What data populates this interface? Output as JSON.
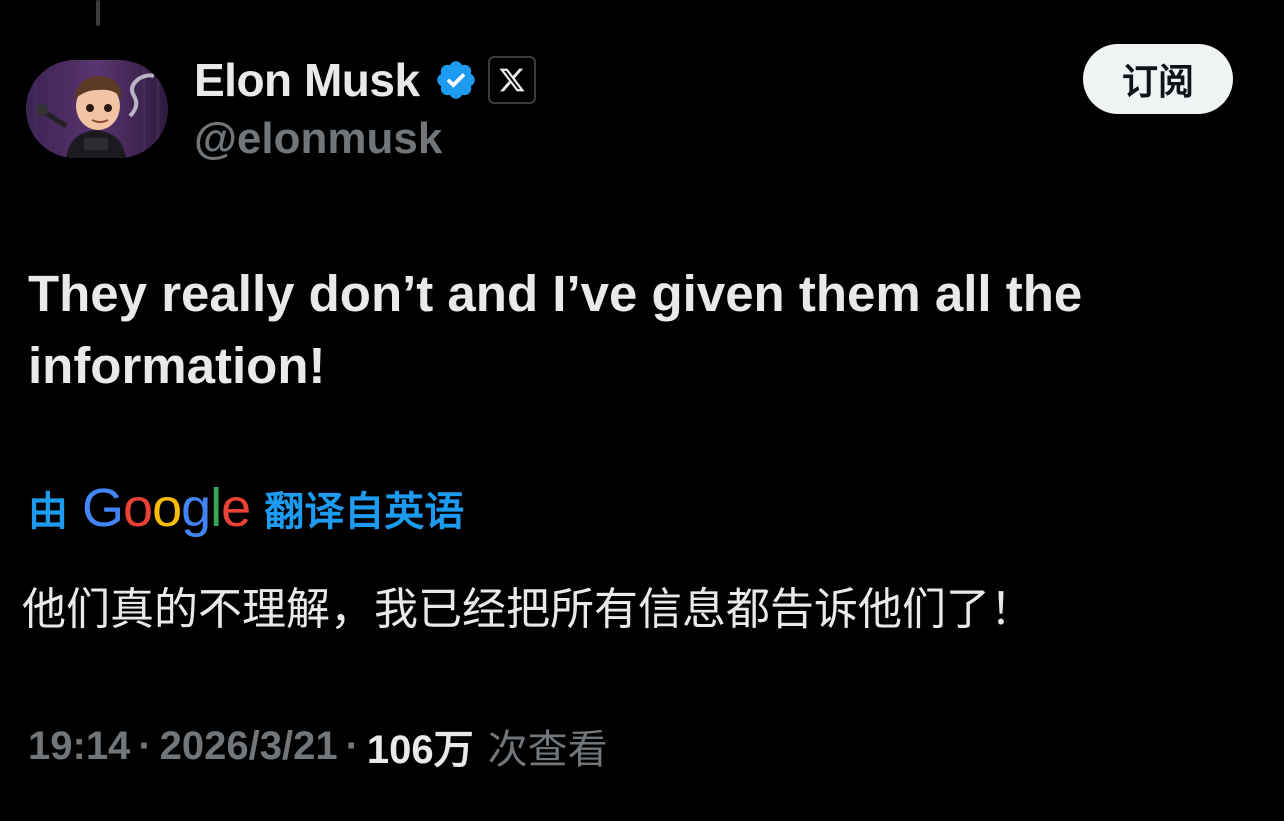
{
  "author": {
    "display_name": "Elon Musk",
    "handle": "@elonmusk",
    "verified_badge_icon": "verified-checkmark-icon",
    "affiliate_icon": "x-logo-icon",
    "avatar_icon": "cartoon-avatar",
    "colors": {
      "verified": "#1d9bf0"
    }
  },
  "actions": {
    "subscribe_label": "订阅"
  },
  "tweet": {
    "text": "They really don’t and I’ve given them all the information!",
    "translation": {
      "prefix": "由",
      "provider_logo_letters": [
        "G",
        "o",
        "o",
        "g",
        "l",
        "e"
      ],
      "provider_logo_colors": [
        "#4285F4",
        "#EA4335",
        "#FBBC05",
        "#4285F4",
        "#34A853",
        "#EA4335"
      ],
      "suffix": "翻译自英语",
      "text": "他们真的不理解，我已经把所有信息都告诉他们了！"
    },
    "meta": {
      "time": "19:14",
      "separator": "·",
      "date": "2026/3/21",
      "views_count": "106万",
      "views_label": "次查看"
    }
  }
}
